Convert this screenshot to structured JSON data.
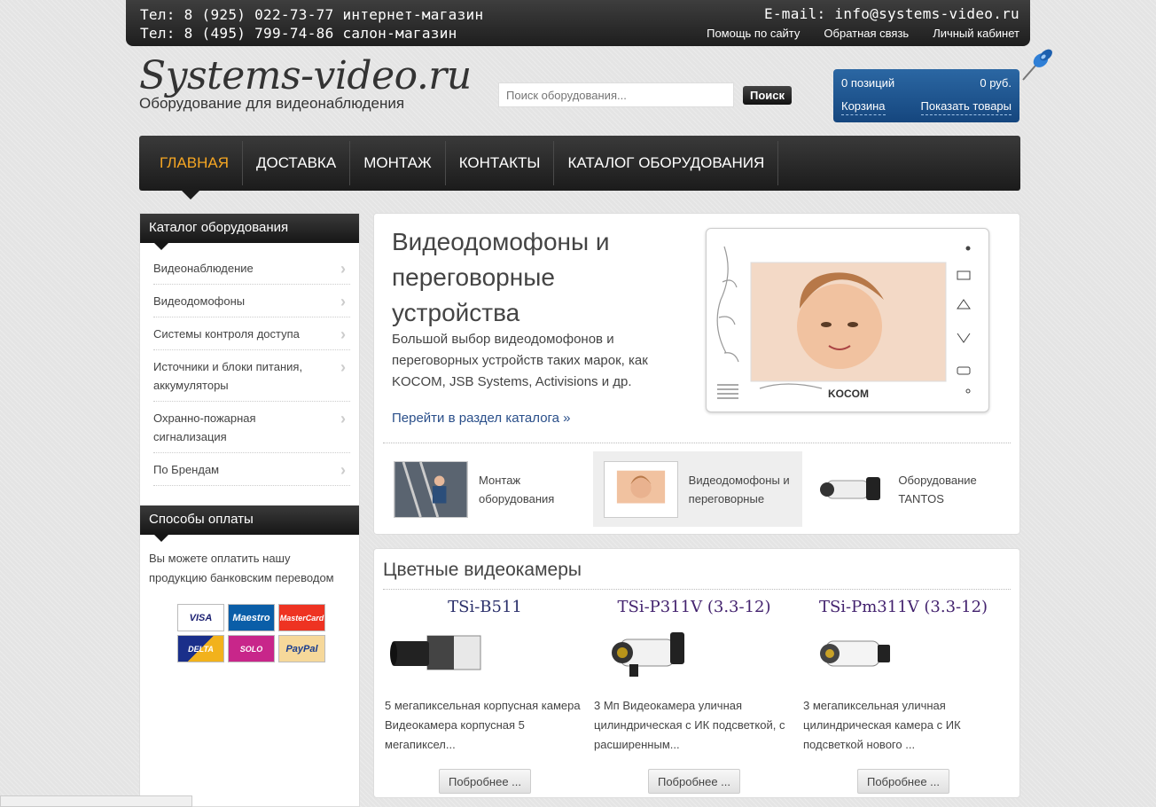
{
  "header": {
    "phone1": "Тел: 8 (925) 022-73-77 интернет-магазин",
    "phone2": "Тел: 8 (495) 799-74-86 салон-магазин",
    "email": "E-mail: info@systems-video.ru",
    "links": [
      "Помощь по сайту",
      "Обратная связь",
      "Личный кабинет"
    ]
  },
  "logo": {
    "title": "Systems-video.ru",
    "subtitle": "Оборудование для видеонаблюдения"
  },
  "search": {
    "placeholder": "Поиск оборудования...",
    "button": "Поиск"
  },
  "cart": {
    "positions": "0 позиций",
    "total": "0 руб.",
    "cart_link": "Корзина",
    "show_link": "Показать товары"
  },
  "nav": [
    "ГЛАВНАЯ",
    "ДОСТАВКА",
    "МОНТАЖ",
    "КОНТАКТЫ",
    "КАТАЛОГ ОБОРУДОВАНИЯ"
  ],
  "sidebar": {
    "catalog_title": "Каталог оборудования",
    "items": [
      "Видеонаблюдение",
      "Видеодомофоны",
      "Системы контроля доступа",
      "Источники и блоки питания, аккумуляторы",
      "Охранно-пожарная сигнализация",
      "По Брендам"
    ],
    "payment_title": "Способы оплаты",
    "payment_text": "Вы можете оплатить нашу продукцию банковским переводом",
    "cards": [
      "VISA",
      "Maestro",
      "MasterCard",
      "DELTA",
      "SOLO",
      "PayPal"
    ]
  },
  "feature": {
    "title": "Видеодомофоны и переговорные устройства",
    "description": " Большой выбор видеодомофонов и переговорных устройств таких марок, как KOCOM, JSB Systems, Activisions и др.",
    "link": "Перейти в раздел каталога »",
    "brand_on_image": "KOCOM",
    "tabs": [
      "Монтаж оборудования",
      "Видеодомофоны и переговорные",
      "Оборудование TANTOS"
    ]
  },
  "products": {
    "title": "Цветные видеокамеры",
    "items": [
      {
        "name": "TSi-B511",
        "desc": "5 мегапиксельная корпусная камера Видеокамера корпусная 5 мегапиксел...",
        "button": "Побробнее ..."
      },
      {
        "name": "TSi-P311V (3.3-12)",
        "desc": "3 Мп Видеокамера уличная цилиндрическая с ИК подсветкой, с расширенным...",
        "button": "Побробнее ..."
      },
      {
        "name": "TSi-Pm311V (3.3-12)",
        "desc": "3 мегапиксельная уличная цилиндрическая камера с ИК подсветкой нового ...",
        "button": "Побробнее ..."
      }
    ]
  }
}
